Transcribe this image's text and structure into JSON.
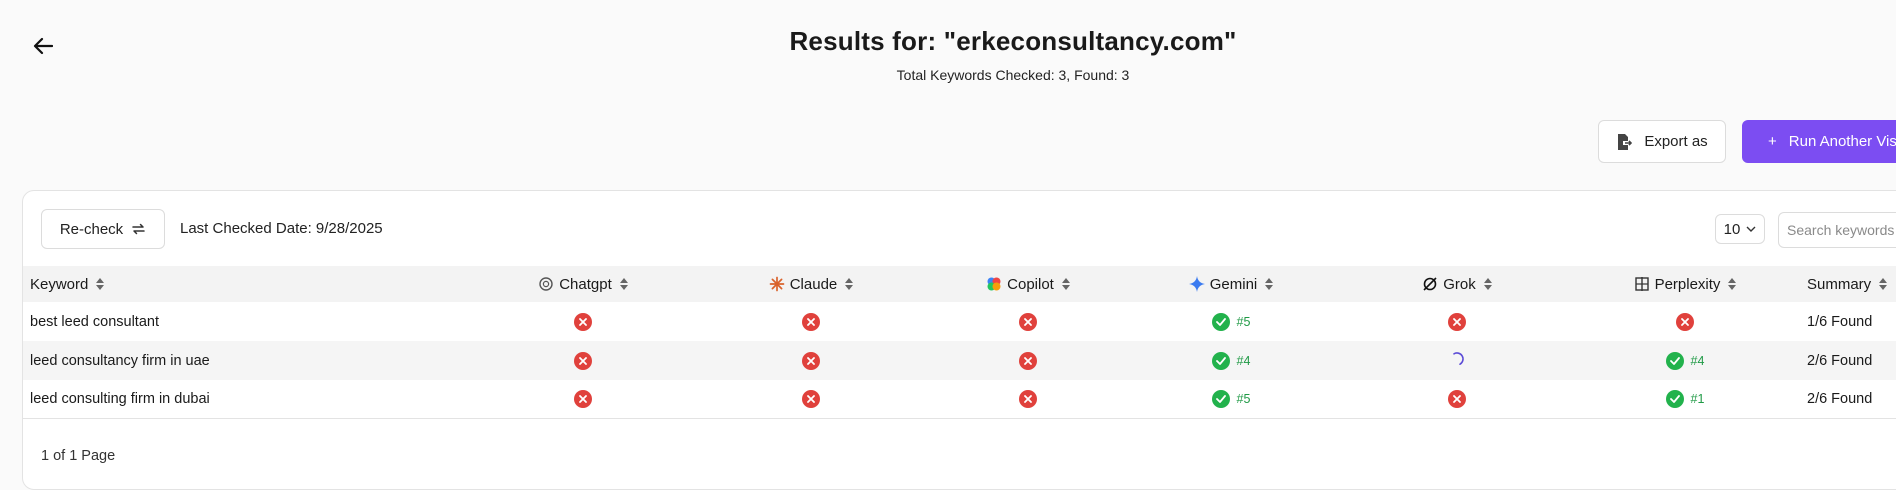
{
  "header": {
    "title": "Results for: \"erkeconsultancy.com\"",
    "subtitle": "Total Keywords Checked: 3, Found: 3"
  },
  "actions": {
    "export_label": "Export as",
    "run_label": "Run Another Visibility",
    "run_prefix": "+"
  },
  "toolbar": {
    "recheck_label": "Re-check",
    "last_checked": "Last Checked Date: 9/28/2025",
    "page_size": "10",
    "search_placeholder": "Search keywords"
  },
  "table": {
    "columns": [
      "Keyword",
      "Chatgpt",
      "Claude",
      "Copilot",
      "Gemini",
      "Grok",
      "Perplexity",
      "Summary"
    ],
    "rows": [
      {
        "keyword": "best leed consultant",
        "results": [
          {
            "status": "not_found"
          },
          {
            "status": "not_found"
          },
          {
            "status": "not_found"
          },
          {
            "status": "found",
            "rank": "#5"
          },
          {
            "status": "not_found"
          },
          {
            "status": "not_found"
          }
        ],
        "summary": "1/6 Found"
      },
      {
        "keyword": "leed consultancy firm in uae",
        "results": [
          {
            "status": "not_found"
          },
          {
            "status": "not_found"
          },
          {
            "status": "not_found"
          },
          {
            "status": "found",
            "rank": "#4"
          },
          {
            "status": "loading"
          },
          {
            "status": "found",
            "rank": "#4"
          }
        ],
        "summary": "2/6 Found"
      },
      {
        "keyword": "leed consulting firm in dubai",
        "results": [
          {
            "status": "not_found"
          },
          {
            "status": "not_found"
          },
          {
            "status": "not_found"
          },
          {
            "status": "found",
            "rank": "#5"
          },
          {
            "status": "not_found"
          },
          {
            "status": "found",
            "rank": "#1"
          }
        ],
        "summary": "2/6 Found"
      }
    ]
  },
  "pagination": {
    "label": "1 of 1 Page"
  },
  "colors": {
    "accent": "#7c4df2",
    "not_found": "#e0413c",
    "found": "#22b24c",
    "loading": "#5b4bd6"
  },
  "icons": [
    "back-arrow-icon",
    "export-icon",
    "plus-icon",
    "refresh-icon",
    "chevron-down-icon",
    "sort-icon",
    "chatgpt-icon",
    "claude-icon",
    "copilot-icon",
    "gemini-icon",
    "grok-icon",
    "perplexity-icon",
    "x-circle-icon",
    "check-circle-icon",
    "spinner-icon"
  ]
}
